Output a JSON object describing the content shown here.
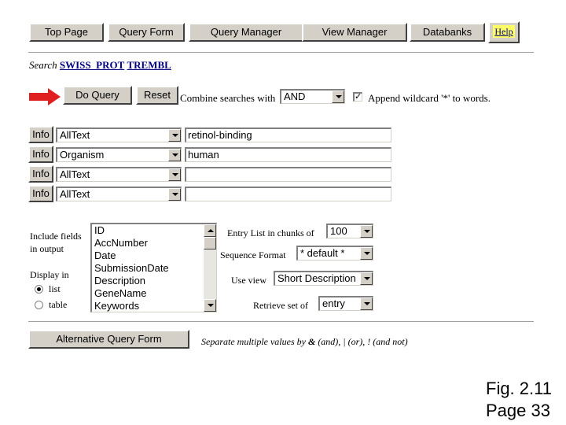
{
  "nav": {
    "top_page": "Top Page",
    "query_form": "Query Form",
    "query_manager": "Query Manager",
    "view_manager": "View Manager",
    "databanks": "Databanks",
    "help": "Help"
  },
  "search": {
    "prefix": "Search",
    "bank1": "SWISS_PROT",
    "bank2": "TREMBL"
  },
  "actions": {
    "do_query": "Do Query",
    "reset": "Reset",
    "combine_label": "Combine searches with",
    "combine_value": "AND",
    "wildcard_label": "Append wildcard '*' to words.",
    "wildcard_checked": "✓"
  },
  "query_rows": [
    {
      "info": "Info",
      "field": "AllText",
      "value": "retinol-binding"
    },
    {
      "info": "Info",
      "field": "Organism",
      "value": "human"
    },
    {
      "info": "Info",
      "field": "AllText",
      "value": ""
    },
    {
      "info": "Info",
      "field": "AllText",
      "value": ""
    }
  ],
  "output": {
    "include_label_line1": "Include fields",
    "include_label_line2": "in output",
    "fields": [
      "ID",
      "AccNumber",
      "Date",
      "SubmissionDate",
      "Description",
      "GeneName",
      "Keywords"
    ],
    "display_in": "Display in",
    "display_list": "list",
    "display_table": "table",
    "chunks_label": "Entry List in chunks of",
    "chunks_value": "100",
    "seq_format_label": "Sequence Format",
    "seq_format_value": "* default *",
    "use_view_label": "Use view",
    "use_view_value": "Short Description",
    "retrieve_label": "Retrieve set of",
    "retrieve_value": "entry"
  },
  "footer": {
    "alt_form": "Alternative Query Form",
    "separate_note_pre": "Separate multiple values by",
    "separate_and_sym": "&",
    "separate_note_post": "(and), | (or), ! (and not)"
  },
  "caption": {
    "line1": "Fig. 2.11",
    "line2": "Page 33"
  },
  "colors": {
    "arrow": "#e02020",
    "link": "#000080",
    "help_bg": "#ffff66"
  }
}
